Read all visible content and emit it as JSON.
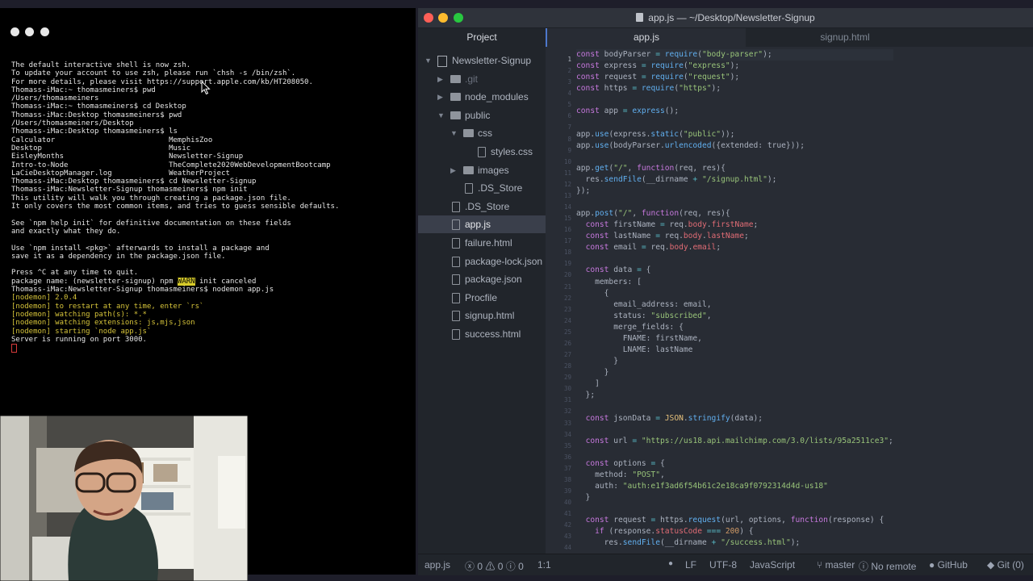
{
  "terminal": {
    "lines": [
      "The default interactive shell is now zsh.",
      "To update your account to use zsh, please run `chsh -s /bin/zsh`.",
      "For more details, please visit https://support.apple.com/kb/HT208050.",
      "Thomass-iMac:~ thomasmeiners$ pwd",
      "/Users/thomasmeiners",
      "Thomass-iMac:~ thomasmeiners$ cd Desktop",
      "Thomass-iMac:Desktop thomasmeiners$ pwd",
      "/Users/thomasmeiners/Desktop",
      "Thomass-iMac:Desktop thomasmeiners$ ls",
      "Calculator                          MemphisZoo",
      "Desktop                             Music",
      "EisleyMonths                        Newsletter-Signup",
      "Intro-to-Node                       TheComplete2020WebDevelopmentBootcamp",
      "LaCieDesktopManager.log             WeatherProject",
      "Thomass-iMac:Desktop thomasmeiners$ cd Newsletter-Signup",
      "Thomass-iMac:Newsletter-Signup thomasmeiners$ npm init",
      "This utility will walk you through creating a package.json file.",
      "It only covers the most common items, and tries to guess sensible defaults.",
      "",
      "See `npm help init` for definitive documentation on these fields",
      "and exactly what they do.",
      "",
      "Use `npm install <pkg>` afterwards to install a package and",
      "save it as a dependency in the package.json file.",
      "",
      "Press ^C at any time to quit."
    ],
    "package_prompt": "package name: (newsletter-signup) npm ",
    "warn_badge": "WARN",
    "warn_text": " init canceled",
    "command_line": "Thomass-iMac:Newsletter-Signup thomasmeiners$ nodemon app.js",
    "nodemon_lines": [
      "[nodemon] 2.0.4",
      "[nodemon] to restart at any time, enter `rs`",
      "[nodemon] watching path(s): *.*",
      "[nodemon] watching extensions: js,mjs,json",
      "[nodemon] starting `node app.js`"
    ],
    "server_line": "Server is running on port 3000."
  },
  "editor": {
    "title": "app.js — ~/Desktop/Newsletter-Signup",
    "tabs": [
      "Project",
      "app.js",
      "signup.html"
    ],
    "tree": [
      {
        "label": "Newsletter-Signup",
        "kind": "repo",
        "depth": 0,
        "chevron": "down"
      },
      {
        "label": ".git",
        "kind": "folder",
        "depth": 1,
        "chevron": "right",
        "muted": true
      },
      {
        "label": "node_modules",
        "kind": "folder",
        "depth": 1,
        "chevron": "right"
      },
      {
        "label": "public",
        "kind": "folder",
        "depth": 1,
        "chevron": "down"
      },
      {
        "label": "css",
        "kind": "folder",
        "depth": 2,
        "chevron": "down"
      },
      {
        "label": "styles.css",
        "kind": "file",
        "depth": 3
      },
      {
        "label": "images",
        "kind": "folder",
        "depth": 2,
        "chevron": "right"
      },
      {
        "label": ".DS_Store",
        "kind": "file",
        "depth": 2
      },
      {
        "label": ".DS_Store",
        "kind": "file",
        "depth": 1
      },
      {
        "label": "app.js",
        "kind": "file",
        "depth": 1,
        "selected": true
      },
      {
        "label": "failure.html",
        "kind": "file",
        "depth": 1
      },
      {
        "label": "package-lock.json",
        "kind": "file",
        "depth": 1
      },
      {
        "label": "package.json",
        "kind": "file",
        "depth": 1
      },
      {
        "label": "Procfile",
        "kind": "file",
        "depth": 1
      },
      {
        "label": "signup.html",
        "kind": "file",
        "depth": 1
      },
      {
        "label": "success.html",
        "kind": "file",
        "depth": 1
      }
    ],
    "code_lines": [
      "const bodyParser = require(\"body-parser\");",
      "const express = require(\"express\");",
      "const request = require(\"request\");",
      "const https = require(\"https\");",
      "",
      "const app = express();",
      "",
      "app.use(express.static(\"public\"));",
      "app.use(bodyParser.urlencoded({extended: true}));",
      "",
      "app.get(\"/\", function(req, res){",
      "  res.sendFile(__dirname + \"/signup.html\");",
      "});",
      "",
      "app.post(\"/\", function(req, res){",
      "  const firstName = req.body.firstName;",
      "  const lastName = req.body.lastName;",
      "  const email = req.body.email;",
      "",
      "  const data = {",
      "    members: [",
      "      {",
      "        email_address: email,",
      "        status: \"subscribed\",",
      "        merge_fields: {",
      "          FNAME: firstName,",
      "          LNAME: lastName",
      "        }",
      "      }",
      "    ]",
      "  };",
      "",
      "  const jsonData = JSON.stringify(data);",
      "",
      "  const url = \"https://us18.api.mailchimp.com/3.0/lists/95a2511ce3\";",
      "",
      "  const options = {",
      "    method: \"POST\",",
      "    auth: \"auth:e1f3ad6f54b61c2e18ca9f0792314d4d-us18\"",
      "  }",
      "",
      "  const request = https.request(url, options, function(response) {",
      "    if (response.statusCode === 200) {",
      "      res.sendFile(__dirname + \"/success.html\");"
    ],
    "status": {
      "file": "app.js",
      "errors": "0",
      "warnings": "0",
      "infos": "0",
      "position": "1:1",
      "line_ending": "LF",
      "encoding": "UTF-8",
      "grammar": "JavaScript",
      "branch": "master",
      "remote": "No remote",
      "github": "GitHub",
      "git": "Git (0)"
    }
  }
}
